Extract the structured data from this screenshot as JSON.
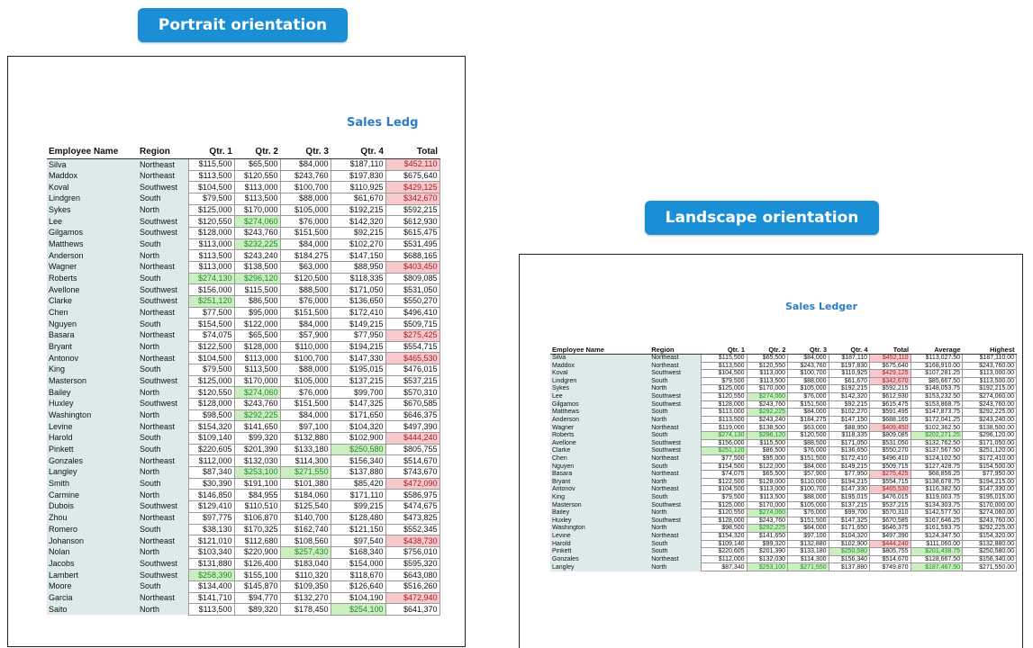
{
  "badges": {
    "portrait": "Portrait orientation",
    "landscape": "Landscape orientation"
  },
  "portrait": {
    "title": "Sales Ledg"
  },
  "landscape": {
    "title": "Sales Ledger"
  },
  "colors": {
    "badge": "#1a8fd6",
    "title": "#2e7cc4",
    "name_fill": "#dcebea",
    "green_fill": "#ccefc2",
    "red_fill": "#f7c9cc"
  },
  "portrait_table": {
    "headers": [
      "Employee Name",
      "Region",
      "Qtr. 1",
      "Qtr. 2",
      "Qtr. 3",
      "Qtr. 4",
      "Total"
    ],
    "rows": [
      {
        "cells": [
          "Silva",
          "Northeast",
          "$115,500",
          "$65,500",
          "$84,000",
          "$187,110",
          "$452,110"
        ],
        "hl": {
          "6": "r"
        }
      },
      {
        "cells": [
          "Maddox",
          "Northeast",
          "$113,500",
          "$120,550",
          "$243,760",
          "$197,830",
          "$675,640"
        ]
      },
      {
        "cells": [
          "Koval",
          "Southwest",
          "$104,500",
          "$113,000",
          "$100,700",
          "$110,925",
          "$429,125"
        ],
        "hl": {
          "6": "r"
        }
      },
      {
        "cells": [
          "Lindgren",
          "South",
          "$79,500",
          "$113,500",
          "$88,000",
          "$61,670",
          "$342,670"
        ],
        "hl": {
          "6": "r"
        }
      },
      {
        "cells": [
          "Sykes",
          "North",
          "$125,000",
          "$170,000",
          "$105,000",
          "$192,215",
          "$592,215"
        ]
      },
      {
        "cells": [
          "Lee",
          "Southwest",
          "$120,550",
          "$274,060",
          "$76,000",
          "$142,320",
          "$612,930"
        ],
        "hl": {
          "3": "g"
        }
      },
      {
        "cells": [
          "Gilgamos",
          "Southwest",
          "$128,000",
          "$243,760",
          "$151,500",
          "$92,215",
          "$615,475"
        ]
      },
      {
        "cells": [
          "Matthews",
          "South",
          "$113,000",
          "$232,225",
          "$84,000",
          "$102,270",
          "$531,495"
        ],
        "hl": {
          "3": "g"
        }
      },
      {
        "cells": [
          "Anderson",
          "North",
          "$113,500",
          "$243,240",
          "$184,275",
          "$147,150",
          "$688,165"
        ]
      },
      {
        "cells": [
          "Wagner",
          "Northeast",
          "$113,000",
          "$138,500",
          "$63,000",
          "$88,950",
          "$403,450"
        ],
        "hl": {
          "6": "r"
        }
      },
      {
        "cells": [
          "Roberts",
          "South",
          "$274,130",
          "$296,120",
          "$120,500",
          "$118,335",
          "$809,085"
        ],
        "hl": {
          "2": "g",
          "3": "g"
        }
      },
      {
        "cells": [
          "Avellone",
          "Southwest",
          "$156,000",
          "$115,500",
          "$88,500",
          "$171,050",
          "$531,050"
        ]
      },
      {
        "cells": [
          "Clarke",
          "Southwest",
          "$251,120",
          "$86,500",
          "$76,000",
          "$136,650",
          "$550,270"
        ],
        "hl": {
          "2": "g"
        }
      },
      {
        "cells": [
          "Chen",
          "Northeast",
          "$77,500",
          "$95,000",
          "$151,500",
          "$172,410",
          "$496,410"
        ]
      },
      {
        "cells": [
          "Nguyen",
          "South",
          "$154,500",
          "$122,000",
          "$84,000",
          "$149,215",
          "$509,715"
        ]
      },
      {
        "cells": [
          "Basara",
          "Northeast",
          "$74,075",
          "$65,500",
          "$57,900",
          "$77,950",
          "$275,425"
        ],
        "hl": {
          "6": "r"
        }
      },
      {
        "cells": [
          "Bryant",
          "North",
          "$122,500",
          "$128,000",
          "$110,000",
          "$194,215",
          "$554,715"
        ]
      },
      {
        "cells": [
          "Antonov",
          "Northeast",
          "$104,500",
          "$113,000",
          "$100,700",
          "$147,330",
          "$465,530"
        ],
        "hl": {
          "6": "r"
        }
      },
      {
        "cells": [
          "King",
          "South",
          "$79,500",
          "$113,500",
          "$88,000",
          "$195,015",
          "$476,015"
        ]
      },
      {
        "cells": [
          "Masterson",
          "Southwest",
          "$125,000",
          "$170,000",
          "$105,000",
          "$137,215",
          "$537,215"
        ]
      },
      {
        "cells": [
          "Bailey",
          "North",
          "$120,550",
          "$274,060",
          "$76,000",
          "$99,700",
          "$570,310"
        ],
        "hl": {
          "3": "g"
        }
      },
      {
        "cells": [
          "Huxley",
          "Southwest",
          "$128,000",
          "$243,760",
          "$151,500",
          "$147,325",
          "$670,585"
        ]
      },
      {
        "cells": [
          "Washington",
          "North",
          "$98,500",
          "$292,225",
          "$84,000",
          "$171,650",
          "$646,375"
        ],
        "hl": {
          "3": "g"
        }
      },
      {
        "cells": [
          "Levine",
          "Northeast",
          "$154,320",
          "$141,650",
          "$97,100",
          "$104,320",
          "$497,390"
        ]
      },
      {
        "cells": [
          "Harold",
          "South",
          "$109,140",
          "$99,320",
          "$132,880",
          "$102,900",
          "$444,240"
        ],
        "hl": {
          "6": "r"
        }
      },
      {
        "cells": [
          "Pinkett",
          "South",
          "$220,605",
          "$201,390",
          "$133,180",
          "$250,580",
          "$805,755"
        ],
        "hl": {
          "5": "g"
        }
      },
      {
        "cells": [
          "Gonzales",
          "Northeast",
          "$112,000",
          "$132,030",
          "$114,300",
          "$156,340",
          "$514,670"
        ]
      },
      {
        "cells": [
          "Langley",
          "North",
          "$87,340",
          "$253,100",
          "$271,550",
          "$137,880",
          "$743,670"
        ],
        "hl": {
          "3": "g",
          "4": "g"
        }
      },
      {
        "cells": [
          "Smith",
          "South",
          "$30,390",
          "$191,100",
          "$101,380",
          "$85,420",
          "$472,090"
        ],
        "hl": {
          "6": "r"
        }
      },
      {
        "cells": [
          "Carmine",
          "North",
          "$146,850",
          "$84,955",
          "$184,060",
          "$171,110",
          "$586,975"
        ]
      },
      {
        "cells": [
          "Dubois",
          "Southwest",
          "$129,410",
          "$110,510",
          "$125,540",
          "$99,215",
          "$474,675"
        ]
      },
      {
        "cells": [
          "Zhou",
          "Northeast",
          "$97,775",
          "$106,870",
          "$140,700",
          "$128,480",
          "$473,825"
        ]
      },
      {
        "cells": [
          "Romero",
          "South",
          "$38,130",
          "$170,325",
          "$162,740",
          "$121,150",
          "$552,345"
        ]
      },
      {
        "cells": [
          "Johanson",
          "Northeast",
          "$121,010",
          "$112,680",
          "$108,560",
          "$97,540",
          "$438,730"
        ],
        "hl": {
          "6": "r"
        }
      },
      {
        "cells": [
          "Nolan",
          "North",
          "$103,340",
          "$220,900",
          "$257,430",
          "$168,340",
          "$756,010"
        ],
        "hl": {
          "4": "g"
        }
      },
      {
        "cells": [
          "Jacobs",
          "Southwest",
          "$131,880",
          "$126,400",
          "$183,040",
          "$154,000",
          "$595,320"
        ]
      },
      {
        "cells": [
          "Lambert",
          "Southwest",
          "$258,390",
          "$155,100",
          "$110,320",
          "$118,670",
          "$643,080"
        ],
        "hl": {
          "2": "g"
        }
      },
      {
        "cells": [
          "Moore",
          "South",
          "$134,400",
          "$145,870",
          "$109,350",
          "$126,640",
          "$516,260"
        ]
      },
      {
        "cells": [
          "Garcia",
          "Northeast",
          "$141,710",
          "$94,770",
          "$132,270",
          "$104,190",
          "$472,940"
        ],
        "hl": {
          "6": "r"
        }
      },
      {
        "cells": [
          "Saito",
          "North",
          "$113,500",
          "$89,320",
          "$178,450",
          "$254,100",
          "$641,370"
        ],
        "hl": {
          "5": "g"
        }
      }
    ]
  },
  "landscape_table": {
    "headers": [
      "Employee Name",
      "Region",
      "Qtr. 1",
      "Qtr. 2",
      "Qtr. 3",
      "Qtr. 4",
      "Total",
      "Average",
      "Highest"
    ],
    "rows": [
      {
        "cells": [
          "Silva",
          "Northeast",
          "$115,500",
          "$65,500",
          "$84,000",
          "$187,110",
          "$452,110",
          "$113,027.50",
          "$187,110.00"
        ],
        "hl": {
          "6": "r"
        }
      },
      {
        "cells": [
          "Maddox",
          "Northeast",
          "$113,500",
          "$120,550",
          "$243,760",
          "$197,830",
          "$675,640",
          "$168,910.00",
          "$243,760.00"
        ]
      },
      {
        "cells": [
          "Koval",
          "Southwest",
          "$104,500",
          "$113,000",
          "$100,700",
          "$110,925",
          "$429,125",
          "$107,281.25",
          "$113,000.00"
        ],
        "hl": {
          "6": "r"
        }
      },
      {
        "cells": [
          "Lindgren",
          "South",
          "$79,500",
          "$113,500",
          "$88,000",
          "$61,670",
          "$342,670",
          "$85,667.50",
          "$113,500.00"
        ],
        "hl": {
          "6": "r"
        }
      },
      {
        "cells": [
          "Sykes",
          "North",
          "$125,000",
          "$170,000",
          "$105,000",
          "$192,215",
          "$592,215",
          "$148,053.75",
          "$192,215.00"
        ]
      },
      {
        "cells": [
          "Lee",
          "Southwest",
          "$120,550",
          "$274,060",
          "$76,000",
          "$142,320",
          "$612,930",
          "$153,232.50",
          "$274,060.00"
        ],
        "hl": {
          "3": "g"
        }
      },
      {
        "cells": [
          "Gilgamos",
          "Southwest",
          "$128,000",
          "$243,760",
          "$151,500",
          "$92,215",
          "$615,475",
          "$153,868.75",
          "$243,760.00"
        ]
      },
      {
        "cells": [
          "Matthews",
          "South",
          "$113,000",
          "$292,225",
          "$84,000",
          "$102,270",
          "$591,495",
          "$147,873.75",
          "$292,225.00"
        ],
        "hl": {
          "3": "g"
        }
      },
      {
        "cells": [
          "Anderson",
          "North",
          "$113,500",
          "$243,240",
          "$184,275",
          "$147,150",
          "$688,165",
          "$172,041.25",
          "$243,240.00"
        ]
      },
      {
        "cells": [
          "Wagner",
          "Northeast",
          "$119,000",
          "$138,500",
          "$63,000",
          "$88,950",
          "$409,450",
          "$102,362.50",
          "$138,500.00"
        ],
        "hl": {
          "6": "r"
        }
      },
      {
        "cells": [
          "Roberts",
          "South",
          "$274,130",
          "$296,120",
          "$120,500",
          "$118,335",
          "$809,085",
          "$202,271.25",
          "$296,120.00"
        ],
        "hl": {
          "2": "g",
          "3": "g",
          "7": "g"
        }
      },
      {
        "cells": [
          "Avellone",
          "Southwest",
          "$156,000",
          "$115,500",
          "$88,500",
          "$171,050",
          "$531,050",
          "$132,762.50",
          "$171,050.00"
        ]
      },
      {
        "cells": [
          "Clarke",
          "Southwest",
          "$251,120",
          "$86,500",
          "$76,000",
          "$136,650",
          "$550,270",
          "$137,567.50",
          "$251,120.00"
        ],
        "hl": {
          "2": "g"
        }
      },
      {
        "cells": [
          "Chen",
          "Northeast",
          "$77,500",
          "$95,000",
          "$151,500",
          "$172,410",
          "$496,410",
          "$124,102.50",
          "$172,410.00"
        ]
      },
      {
        "cells": [
          "Nguyen",
          "South",
          "$154,500",
          "$122,000",
          "$84,000",
          "$149,215",
          "$509,715",
          "$127,428.75",
          "$154,500.00"
        ]
      },
      {
        "cells": [
          "Basara",
          "Northeast",
          "$74,075",
          "$65,500",
          "$57,900",
          "$77,950",
          "$275,425",
          "$68,856.25",
          "$77,950.00"
        ],
        "hl": {
          "6": "r"
        }
      },
      {
        "cells": [
          "Bryant",
          "North",
          "$122,500",
          "$128,000",
          "$110,000",
          "$194,215",
          "$554,715",
          "$138,678.75",
          "$194,215.00"
        ]
      },
      {
        "cells": [
          "Antonov",
          "Northeast",
          "$104,500",
          "$113,000",
          "$100,700",
          "$147,330",
          "$465,530",
          "$116,382.50",
          "$147,330.00"
        ],
        "hl": {
          "6": "r"
        }
      },
      {
        "cells": [
          "King",
          "South",
          "$79,500",
          "$113,500",
          "$88,000",
          "$195,015",
          "$476,015",
          "$119,003.75",
          "$195,015.00"
        ]
      },
      {
        "cells": [
          "Masterson",
          "Southwest",
          "$125,000",
          "$170,000",
          "$105,000",
          "$137,215",
          "$537,215",
          "$134,303.75",
          "$170,000.00"
        ]
      },
      {
        "cells": [
          "Bailey",
          "North",
          "$120,550",
          "$274,060",
          "$76,000",
          "$99,700",
          "$570,310",
          "$142,577.50",
          "$274,060.00"
        ],
        "hl": {
          "3": "g"
        }
      },
      {
        "cells": [
          "Huxley",
          "Southwest",
          "$128,000",
          "$243,760",
          "$151,500",
          "$147,325",
          "$670,585",
          "$167,646.25",
          "$243,760.00"
        ]
      },
      {
        "cells": [
          "Washington",
          "North",
          "$98,500",
          "$292,225",
          "$84,000",
          "$171,650",
          "$646,375",
          "$161,593.75",
          "$292,225.00"
        ],
        "hl": {
          "3": "g"
        }
      },
      {
        "cells": [
          "Levine",
          "Northeast",
          "$154,320",
          "$141,650",
          "$97,100",
          "$104,320",
          "$497,390",
          "$124,347.50",
          "$154,320.00"
        ]
      },
      {
        "cells": [
          "Harold",
          "South",
          "$109,140",
          "$99,320",
          "$132,880",
          "$102,900",
          "$444,240",
          "$111,060.00",
          "$132,880.00"
        ],
        "hl": {
          "6": "r"
        }
      },
      {
        "cells": [
          "Pinkett",
          "South",
          "$220,605",
          "$201,390",
          "$133,180",
          "$250,580",
          "$805,755",
          "$201,438.75",
          "$250,580.00"
        ],
        "hl": {
          "5": "g",
          "7": "g"
        }
      },
      {
        "cells": [
          "Gonzales",
          "Northeast",
          "$112,000",
          "$132,030",
          "$114,300",
          "$156,340",
          "$514,670",
          "$128,667.50",
          "$156,340.00"
        ]
      },
      {
        "cells": [
          "Langley",
          "North",
          "$87,340",
          "$253,100",
          "$271,550",
          "$137,880",
          "$749,870",
          "$187,467.50",
          "$271,550.00"
        ],
        "hl": {
          "3": "g",
          "4": "g",
          "7": "g"
        }
      }
    ]
  }
}
